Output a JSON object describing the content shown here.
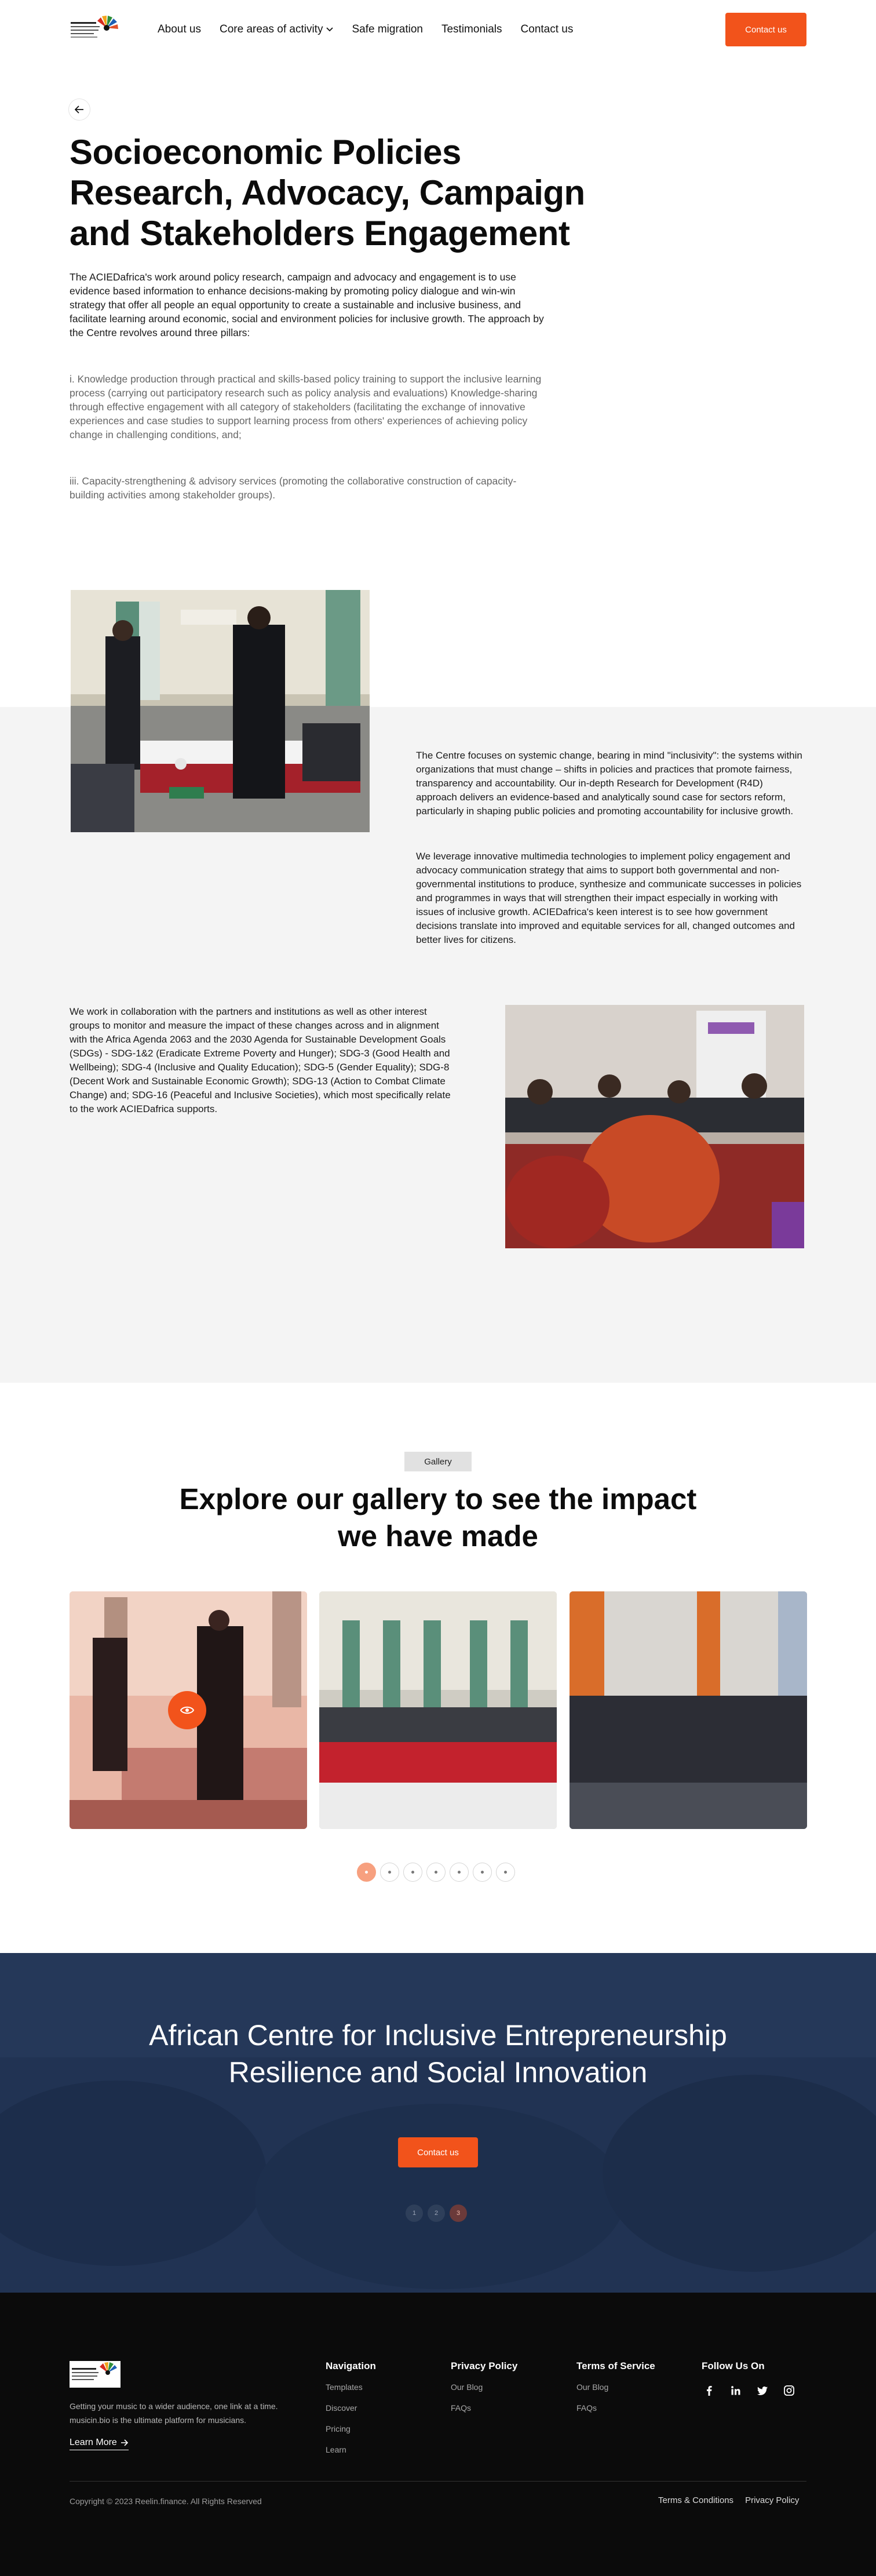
{
  "nav": {
    "links": [
      "About us",
      "Core areas of activity",
      "Safe migration",
      "Testimonials",
      "Contact us"
    ],
    "cta": "Contact us"
  },
  "hero": {
    "title": "Socioeconomic Policies Research, Advocacy, Campaign and Stakeholders Engagement",
    "p1": "The ACIEDafrica's work around policy research, campaign and advocacy and engagement is to use evidence based information to enhance decisions-making by promoting policy dialogue and win-win strategy that offer all people an equal opportunity to create a sustainable and inclusive business, and facilitate learning around economic, social and environment policies for inclusive growth. The approach by the Centre revolves around three pillars:",
    "p2": "i. Knowledge production through practical and skills-based policy training to support the inclusive learning process (carrying out participatory research such as policy analysis and evaluations) Knowledge-sharing through effective engagement with all category of stakeholders (facilitating the exchange of innovative experiences and case studies to support learning process from others' experiences of achieving policy change in challenging conditions, and;",
    "p3": "iii. Capacity-strengthening & advisory services (promoting the collaborative construction of capacity-building activities among stakeholder groups)."
  },
  "about": {
    "p1": "The Centre focuses on systemic change, bearing in mind \"inclusivity\": the systems within organizations that must change – shifts in policies and practices that promote fairness, transparency and accountability. Our in-depth Research for Development (R4D) approach delivers an evidence-based and analytically sound case for sectors reform, particularly in shaping public policies and promoting accountability for inclusive growth.",
    "p2": "We leverage innovative multimedia technologies to implement policy engagement and advocacy communication strategy that aims to support both governmental and non-governmental institutions to produce, synthesize and communicate successes in policies and programmes in ways that will strengthen their impact especially in working with issues of inclusive growth. ACIEDafrica's keen interest is to see how government decisions translate into improved and equitable services for all, changed outcomes and better lives for citizens.",
    "p3": "We work in collaboration with the partners and institutions as well as other interest groups to monitor and measure the impact of these changes across and in alignment with the Africa Agenda 2063 and the 2030 Agenda for Sustainable Development Goals (SDGs) - SDG-1&2 (Eradicate Extreme Poverty and Hunger); SDG-3 (Good Health and Wellbeing); SDG-4 (Inclusive and Quality Education); SDG-5 (Gender Equality); SDG-8 (Decent Work and Sustainable Economic Growth); SDG-13 (Action to Combat Climate Change) and; SDG-16 (Peaceful and Inclusive Societies),  which most specifically relate to the work ACIEDafrica supports."
  },
  "gallery": {
    "badge": "Gallery",
    "title": "Explore our gallery to see the impact we have made"
  },
  "banner": {
    "title": "African Centre for Inclusive Entrepreneurship Resilience and Social Innovation",
    "cta": "Contact us",
    "dots": [
      "1",
      "2",
      "3"
    ]
  },
  "footer": {
    "about": "Getting your music to a wider audience, one link at a time. musicin.bio is the ultimate platform for musicians.",
    "learn_more": "Learn More",
    "col1": {
      "title": "Navigation",
      "items": [
        "Templates",
        "Discover",
        "Pricing",
        "Learn"
      ]
    },
    "col2": {
      "title": "Privacy Policy",
      "items": [
        "Our Blog",
        "FAQs"
      ]
    },
    "col3": {
      "title": "Terms of Service",
      "items": [
        "Our Blog",
        "FAQs"
      ]
    },
    "col4": {
      "title": "Follow Us On"
    },
    "copyright": "Copyright © 2023 Reelin.finance. All Rights Reserved",
    "terms": "Terms & Conditions",
    "privacy": "Privacy Policy"
  },
  "colors": {
    "accent": "#f2531b",
    "footer_bg": "#0b0b0b",
    "banner_bg": "#1f3050",
    "section_bg": "#f4f4f4"
  },
  "icons": [
    "back-arrow-icon",
    "chevron-down-icon",
    "eye-icon",
    "arrow-right-icon",
    "facebook-icon",
    "linkedin-icon",
    "twitter-icon",
    "instagram-icon"
  ]
}
